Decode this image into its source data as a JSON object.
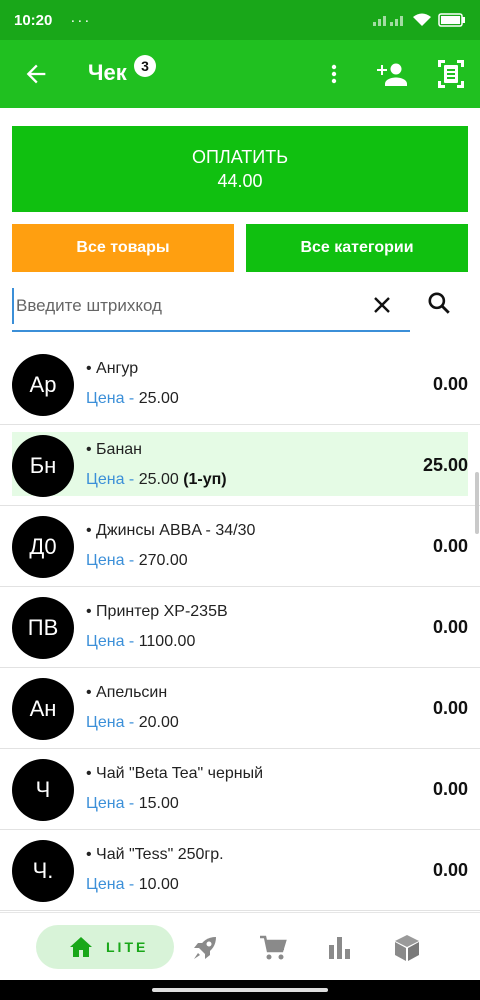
{
  "status_bar": {
    "time": "10:20",
    "dots": "···"
  },
  "header": {
    "title": "Чек",
    "badge_count": "3"
  },
  "pay": {
    "label": "ОПЛАТИТЬ",
    "amount": "44.00"
  },
  "filters": {
    "all_products": "Все товары",
    "all_categories": "Все категории"
  },
  "search": {
    "placeholder": "Введите штрихкод"
  },
  "products": [
    {
      "initials": "Ар",
      "name": "• Ангур",
      "price_label": "Цена -",
      "price": " 25.00",
      "unit_note": "",
      "total": "0.00",
      "highlight": false
    },
    {
      "initials": "Бн",
      "name": "• Банан",
      "price_label": "Цена -",
      "price": " 25.00 ",
      "unit_note": "(1-уп)",
      "total": "25.00",
      "highlight": true
    },
    {
      "initials": "Д0",
      "name": "• Джинсы ABBA - 34/30",
      "price_label": "Цена -",
      "price": " 270.00",
      "unit_note": "",
      "total": "0.00",
      "highlight": false
    },
    {
      "initials": "ПВ",
      "name": "• Принтер XP-235B",
      "price_label": "Цена -",
      "price": " 1100.00",
      "unit_note": "",
      "total": "0.00",
      "highlight": false
    },
    {
      "initials": "Ан",
      "name": "• Апельсин",
      "price_label": "Цена -",
      "price": " 20.00",
      "unit_note": "",
      "total": "0.00",
      "highlight": false
    },
    {
      "initials": "Ч",
      "name": "• Чай \"Beta Tea\" черный",
      "price_label": "Цена -",
      "price": " 15.00",
      "unit_note": "",
      "total": "0.00",
      "highlight": false
    },
    {
      "initials": "Ч.",
      "name": "• Чай \"Tess\" 250гр.",
      "price_label": "Цена -",
      "price": " 10.00",
      "unit_note": "",
      "total": "0.00",
      "highlight": false
    }
  ],
  "nav": {
    "lite_label": "LITE"
  },
  "colors": {
    "header_green": "#20c020",
    "status_green": "#19a719",
    "pay_green": "#10c010",
    "orange": "#ff9f10",
    "price_blue": "#3b8fd8",
    "highlight": "#e5fbe5"
  },
  "icons": [
    "arrow-back-icon",
    "more-vert-icon",
    "person-add-icon",
    "scanner-icon",
    "close-icon",
    "search-icon",
    "home-icon",
    "rocket-icon",
    "cart-icon",
    "bar-chart-icon",
    "box-icon"
  ]
}
